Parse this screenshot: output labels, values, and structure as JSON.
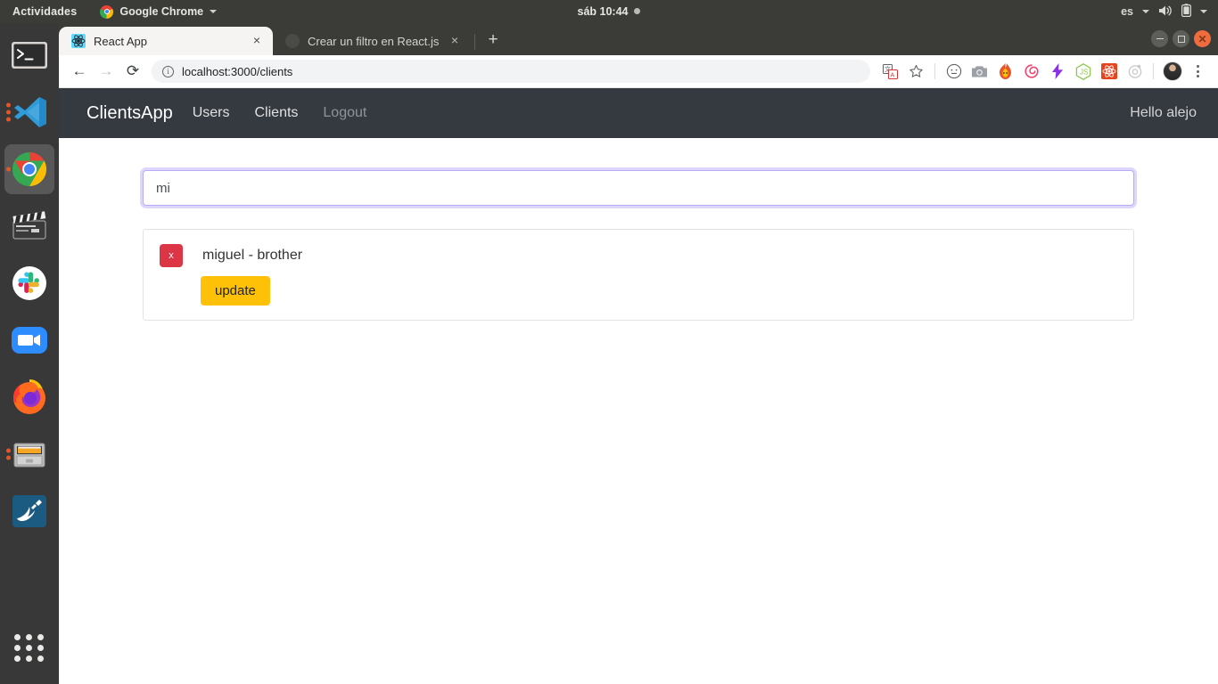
{
  "os_topbar": {
    "activities": "Actividades",
    "app_menu": {
      "name": "Google Chrome",
      "icon": "chrome-icon",
      "caret": "chevron-down-icon"
    },
    "clock": "sáb 10:44",
    "tray": {
      "language": "es",
      "volume_icon": "volume-icon",
      "battery_icon": "battery-icon",
      "menu_caret": "chevron-down-icon"
    }
  },
  "dock": {
    "items": [
      {
        "name": "terminal",
        "label": "Terminal",
        "running": false,
        "active": false
      },
      {
        "name": "vscode",
        "label": "Visual Studio Code",
        "running": true,
        "active": false
      },
      {
        "name": "chrome",
        "label": "Google Chrome",
        "running": true,
        "active": true
      },
      {
        "name": "video-editor",
        "label": "Video Editor",
        "running": false,
        "active": false
      },
      {
        "name": "slack",
        "label": "Slack",
        "running": false,
        "active": false
      },
      {
        "name": "zoom",
        "label": "Zoom",
        "running": false,
        "active": false
      },
      {
        "name": "firefox",
        "label": "Firefox",
        "running": false,
        "active": false
      },
      {
        "name": "file-manager",
        "label": "Files",
        "running": true,
        "active": false
      },
      {
        "name": "mysql-workbench",
        "label": "MySQL Workbench",
        "running": false,
        "active": false
      }
    ],
    "show_apps_label": "Show Applications"
  },
  "browser": {
    "tabs": [
      {
        "title": "React App",
        "favicon": "react-icon",
        "active": true,
        "close_label": "×"
      },
      {
        "title": "Crear un filtro en React.js,",
        "favicon": "blank-icon",
        "active": false,
        "close_label": "×"
      }
    ],
    "new_tab_label": "+",
    "window_controls": {
      "minimize": "−",
      "maximize": "□",
      "close": "×"
    },
    "toolbar": {
      "back_label": "←",
      "forward_label": "→",
      "reload_label": "⟳",
      "site_info_label": "i",
      "url": "localhost:3000/clients",
      "translate_icon": "translate-icon",
      "bookmark_icon": "star-icon",
      "extensions": [
        {
          "name": "emoji-face-icon",
          "color": "#5f6368"
        },
        {
          "name": "camera-icon",
          "color": "#9aa0a6"
        },
        {
          "name": "fire-icon",
          "color": "#ff7043"
        },
        {
          "name": "spiral-icon",
          "color": "#f4436c"
        },
        {
          "name": "lightning-bolt-icon",
          "color": "#8b2fe8"
        },
        {
          "name": "nodejs-icon",
          "color": "#8cc84b"
        },
        {
          "name": "react-devtools-icon",
          "color": "#e8431f"
        },
        {
          "name": "target-icon",
          "color": "#c8c8c8"
        }
      ],
      "profile_avatar": "avatar",
      "menu_icon": "kebab-menu-icon"
    }
  },
  "app": {
    "navbar": {
      "brand": "ClientsApp",
      "links": [
        {
          "label": "Users",
          "muted": false
        },
        {
          "label": "Clients",
          "muted": false
        },
        {
          "label": "Logout",
          "muted": true
        }
      ],
      "greeting": "Hello alejo",
      "bg_color": "#343a40"
    },
    "search": {
      "value": "mi",
      "placeholder": ""
    },
    "clients": [
      {
        "label": "miguel - brother",
        "delete_label": "x",
        "update_label": "update"
      }
    ],
    "colors": {
      "danger": "#dc3545",
      "warning": "#ffc107",
      "focus_ring": "#805cf0"
    }
  }
}
